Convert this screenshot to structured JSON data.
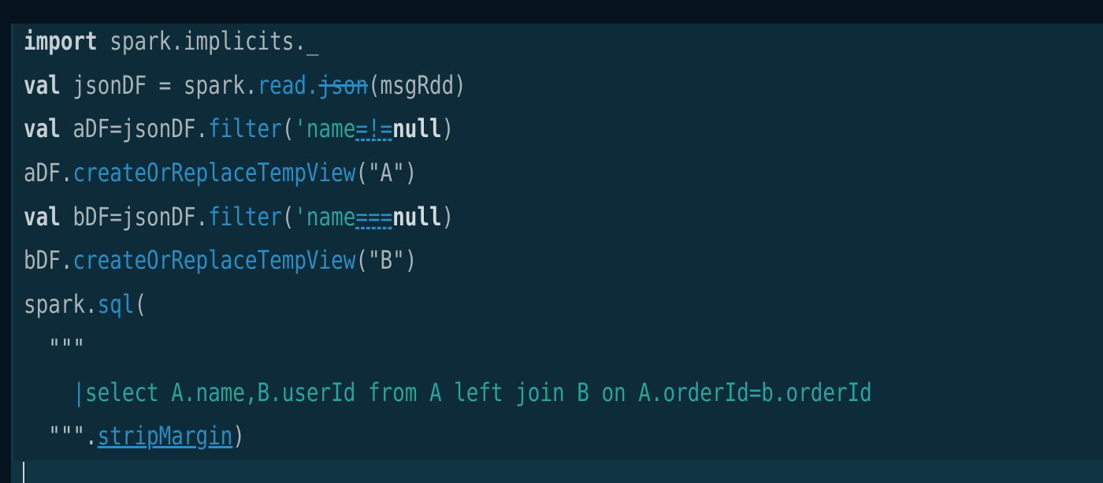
{
  "code": {
    "line1": {
      "kw": "import",
      "rest": " spark.implicits._"
    },
    "line2": {
      "kw": "val",
      "p1": " jsonDF = spark.",
      "m1": "read",
      "dot": ".",
      "m2": "json",
      "p2": "(msgRdd)"
    },
    "line3": {
      "kw": "val",
      "p1": " aDF=jsonDF.",
      "m1": "filter",
      "p2": "(",
      "sym": "'name",
      "op": "=!=",
      "lit": "null",
      "p3": ")"
    },
    "line4": {
      "p1": "aDF.",
      "m1": "createOrReplaceTempView",
      "p2": "(\"A\")"
    },
    "line5": {
      "kw": "val",
      "p1": " bDF=jsonDF.",
      "m1": "filter",
      "p2": "(",
      "sym": "'name",
      "op": "===",
      "lit": "null",
      "p3": ")"
    },
    "line6": {
      "p1": "bDF.",
      "m1": "createOrReplaceTempView",
      "p2": "(\"B\")"
    },
    "line7": {
      "p1": "spark.",
      "m1": "sql",
      "p2": "("
    },
    "line8": {
      "p1": "  \"\"\""
    },
    "line9": {
      "indent": "    ",
      "bar": "|",
      "sql": "select A.name,B.userId from A left join B on A.orderId=b.orderId"
    },
    "line10": {
      "p1": "  \"\"\".",
      "m1": "stripMargin",
      "p2": ")"
    }
  },
  "colors": {
    "background": "#06121d",
    "editor": "#0d2b38",
    "method": "#2a8ec4",
    "symbol": "#2aa39a",
    "keyword": "#c5ced2"
  }
}
